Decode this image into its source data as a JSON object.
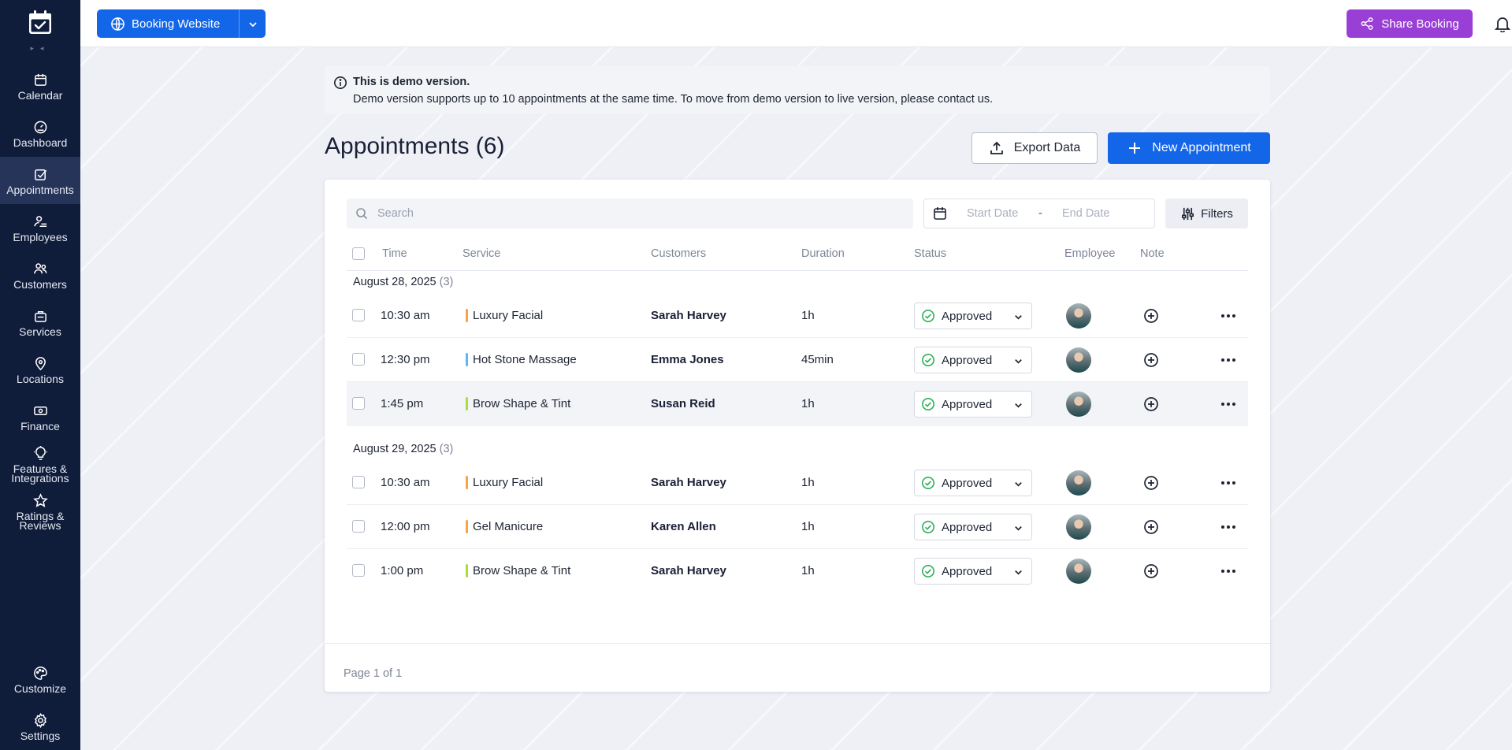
{
  "sidebar": {
    "items": [
      {
        "label": "Calendar",
        "icon": "calendar-icon"
      },
      {
        "label": "Dashboard",
        "icon": "gauge-icon"
      },
      {
        "label": "Appointments",
        "icon": "checkbox-icon",
        "active": true
      },
      {
        "label": "Employees",
        "icon": "employees-icon"
      },
      {
        "label": "Customers",
        "icon": "customers-icon"
      },
      {
        "label": "Services",
        "icon": "bag-icon"
      },
      {
        "label": "Locations",
        "icon": "pin-icon"
      },
      {
        "label": "Finance",
        "icon": "money-icon"
      },
      {
        "label_line1": "Features &",
        "label_line2": "Integrations",
        "icon": "bulb-icon"
      },
      {
        "label_line1": "Ratings &",
        "label_line2": "Reviews",
        "icon": "star-icon"
      }
    ],
    "bottom": [
      {
        "label": "Customize",
        "icon": "palette-icon"
      },
      {
        "label": "Settings",
        "icon": "gear-icon"
      }
    ]
  },
  "header": {
    "booking_label": "Booking Website",
    "share_label": "Share Booking"
  },
  "notice": {
    "title": "This is demo version.",
    "text": "Demo version supports up to 10 appointments at the same time. To move from demo version to live version, please contact us."
  },
  "page": {
    "title": "Appointments (6)",
    "export_label": "Export Data",
    "new_label": "New Appointment"
  },
  "toolbar": {
    "search_placeholder": "Search",
    "start_date": "Start Date",
    "dash": "-",
    "end_date": "End Date",
    "filters_label": "Filters"
  },
  "table": {
    "columns": [
      "Time",
      "Service",
      "Customers",
      "Duration",
      "Status",
      "Employee",
      "Note"
    ],
    "groups": [
      {
        "date": "August 28, 2025",
        "count": "(3)",
        "rows": [
          {
            "time": "10:30 am",
            "service": "Luxury Facial",
            "color": "#f5a545",
            "customer": "Sarah Harvey",
            "duration": "1h",
            "status": "Approved"
          },
          {
            "time": "12:30 pm",
            "service": "Hot Stone Massage",
            "color": "#5cb6f0",
            "customer": "Emma Jones",
            "duration": "45min",
            "status": "Approved"
          },
          {
            "time": "1:45 pm",
            "service": "Brow Shape & Tint",
            "color": "#a7dd3c",
            "customer": "Susan Reid",
            "duration": "1h",
            "status": "Approved"
          }
        ]
      },
      {
        "date": "August 29, 2025",
        "count": "(3)",
        "rows": [
          {
            "time": "10:30 am",
            "service": "Luxury Facial",
            "color": "#f5a545",
            "customer": "Sarah Harvey",
            "duration": "1h",
            "status": "Approved"
          },
          {
            "time": "12:00 pm",
            "service": "Gel Manicure",
            "color": "#f5a545",
            "customer": "Karen Allen",
            "duration": "1h",
            "status": "Approved"
          },
          {
            "time": "1:00 pm",
            "service": "Brow Shape & Tint",
            "color": "#a7dd3c",
            "customer": "Sarah Harvey",
            "duration": "1h",
            "status": "Approved"
          }
        ]
      }
    ]
  },
  "footer": {
    "pagination": "Page 1 of 1"
  },
  "colors": {
    "primary": "#1366e8",
    "share": "#9a3fd6",
    "sidebar": "#0f1c3a",
    "approved": "#2fae5a"
  }
}
